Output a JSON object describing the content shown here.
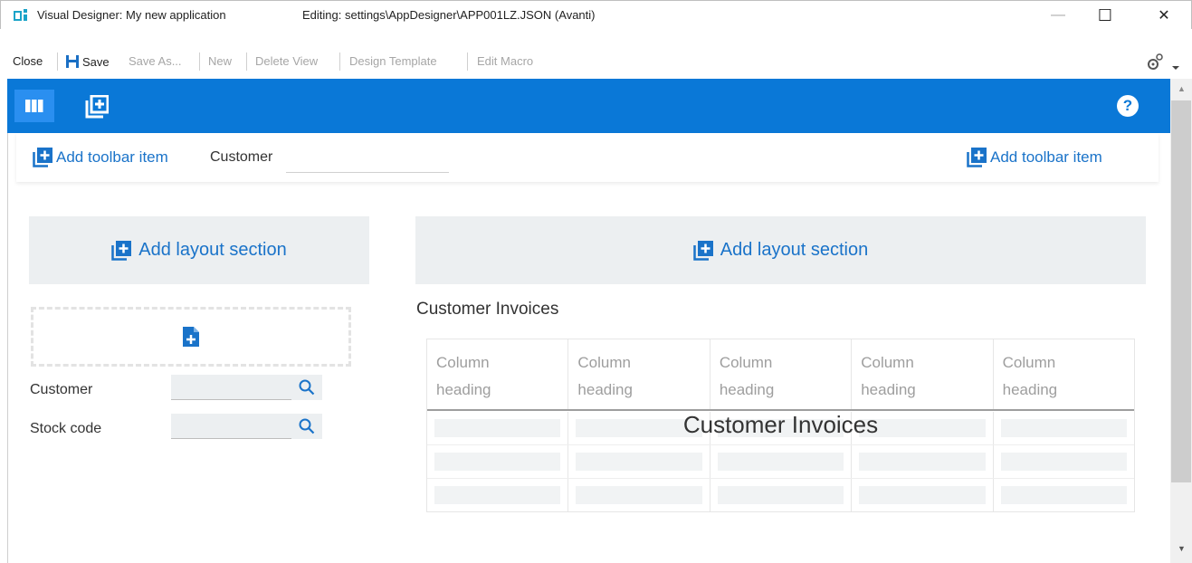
{
  "window": {
    "title": "Visual Designer: My new application",
    "editing": "Editing: settings\\AppDesigner\\APP001LZ.JSON (Avanti)",
    "minimize": "—",
    "maximize": "☐",
    "close": "✕"
  },
  "menu": {
    "close": "Close",
    "save": "Save",
    "save_as": "Save As...",
    "new": "New",
    "delete_view": "Delete View",
    "design_template": "Design Template",
    "edit_macro": "Edit Macro"
  },
  "header": {
    "help": "?"
  },
  "toolbar": {
    "add_item_left": "Add toolbar item",
    "customer_label": "Customer",
    "customer_value": "",
    "add_item_right": "Add toolbar item"
  },
  "layout": {
    "add_section_left": "Add layout section",
    "add_section_right": "Add layout section"
  },
  "form": {
    "customer_label": "Customer",
    "stock_code_label": "Stock code"
  },
  "grid": {
    "title": "Customer Invoices",
    "overlay": "Customer Invoices",
    "columns": [
      {
        "line1": "Column",
        "line2": "heading"
      },
      {
        "line1": "Column",
        "line2": "heading"
      },
      {
        "line1": "Column",
        "line2": "heading"
      },
      {
        "line1": "Column",
        "line2": "heading"
      },
      {
        "line1": "Column",
        "line2": "heading"
      }
    ]
  },
  "colors": {
    "header_blue": "#0a78d7",
    "link_blue": "#1a73c9",
    "panel_grey": "#eceff1"
  }
}
